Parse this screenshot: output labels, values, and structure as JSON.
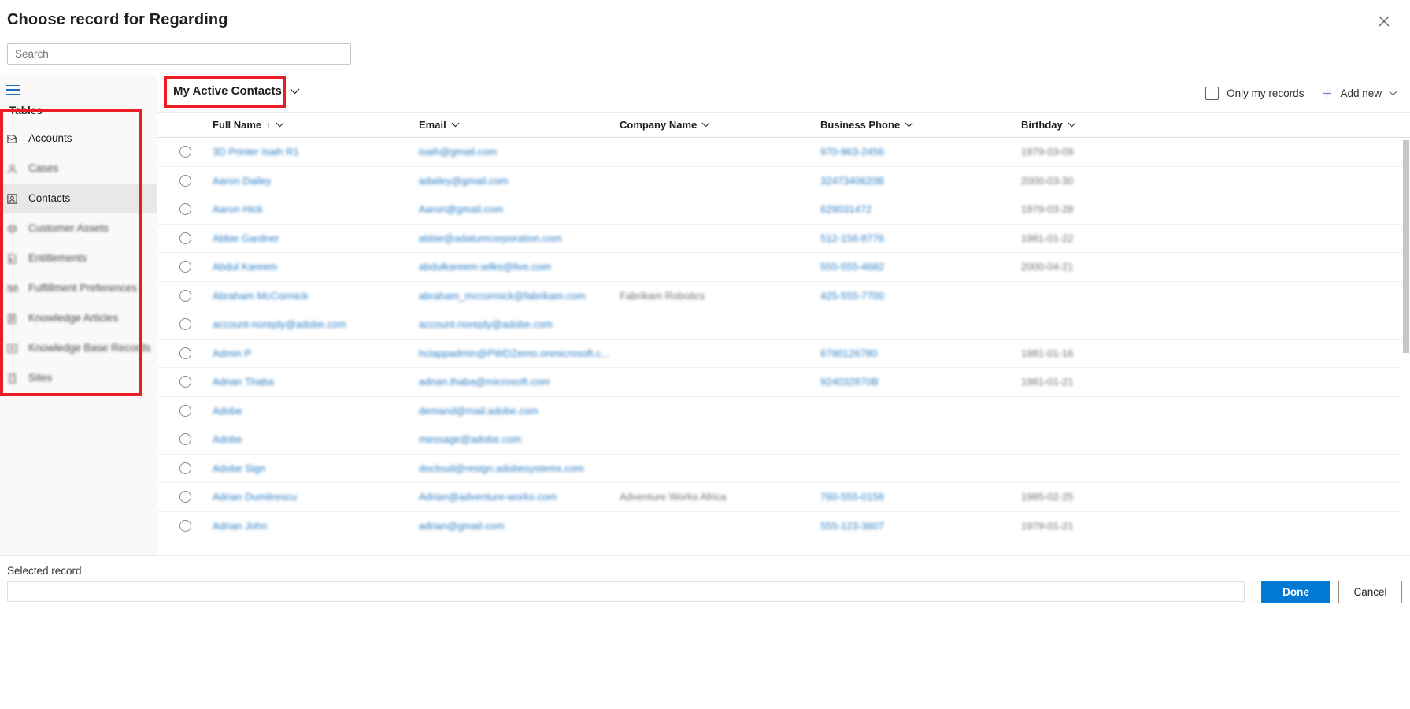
{
  "dialog": {
    "title": "Choose record for Regarding",
    "close_label": "Close"
  },
  "search": {
    "placeholder": "Search",
    "value": ""
  },
  "sidebar": {
    "menu_icon": "hamburger-icon",
    "section_title": "Tables",
    "items": [
      {
        "label": "Accounts",
        "icon": "account-icon",
        "selected": false,
        "blurred": false
      },
      {
        "label": "Cases",
        "icon": "case-icon",
        "selected": false,
        "blurred": true
      },
      {
        "label": "Contacts",
        "icon": "contact-icon",
        "selected": true,
        "blurred": false
      },
      {
        "label": "Customer Assets",
        "icon": "asset-icon",
        "selected": false,
        "blurred": true
      },
      {
        "label": "Entitlements",
        "icon": "entitlement-icon",
        "selected": false,
        "blurred": true
      },
      {
        "label": "Fulfillment Preferences",
        "icon": "people-icon",
        "selected": false,
        "blurred": true
      },
      {
        "label": "Knowledge Articles",
        "icon": "article-icon",
        "selected": false,
        "blurred": true
      },
      {
        "label": "Knowledge Base Records",
        "icon": "kb-icon",
        "selected": false,
        "blurred": true
      },
      {
        "label": "Sites",
        "icon": "site-icon",
        "selected": false,
        "blurred": true
      }
    ]
  },
  "command_bar": {
    "view_name": "My Active Contacts",
    "view_chevron_icon": "chevron-down-icon",
    "only_my_records_label": "Only my records",
    "only_my_records_checked": false,
    "add_new_label": "Add new",
    "add_new_plus_icon": "plus-icon",
    "add_new_chevron_icon": "chevron-down-icon"
  },
  "grid": {
    "columns": [
      {
        "label": "Full Name",
        "sorted": true,
        "sort_icon": "sort-ascending-icon"
      },
      {
        "label": "Email",
        "sorted": false
      },
      {
        "label": "Company Name",
        "sorted": false
      },
      {
        "label": "Business Phone",
        "sorted": false
      },
      {
        "label": "Birthday",
        "sorted": false
      }
    ],
    "rows": [
      {
        "full_name": "3D Printer Isaih R1",
        "email": "isaih@gmail.com",
        "company": "",
        "phone": "970-963-2456",
        "birthday": "1979-03-09"
      },
      {
        "full_name": "Aaron Dailey",
        "email": "adailey@gmail.com",
        "company": "",
        "phone": "3247340620B",
        "birthday": "2000-03-30"
      },
      {
        "full_name": "Aaron Hick",
        "email": "Aaron@gmail.com",
        "company": "",
        "phone": "629031472",
        "birthday": "1979-03-28"
      },
      {
        "full_name": "Abbie Gardner",
        "email": "abbie@adatumcorporation.com",
        "company": "",
        "phone": "512-156-8776",
        "birthday": "1981-01-22"
      },
      {
        "full_name": "Abdul Kareem",
        "email": "abdulkareem.wilks@live.com",
        "company": "",
        "phone": "555-555-4682",
        "birthday": "2000-04-21"
      },
      {
        "full_name": "Abraham McCormick",
        "email": "abraham_mccormick@fabrikam.com",
        "company": "Fabrikam Robotics",
        "phone": "425-555-7700",
        "birthday": ""
      },
      {
        "full_name": "account-noreply@adobe.com",
        "email": "account-noreply@adobe.com",
        "company": "",
        "phone": "",
        "birthday": ""
      },
      {
        "full_name": "Admin P",
        "email": "hclappadmin@PWDZemo.onmicrosoft.c...",
        "company": "",
        "phone": "6790126780",
        "birthday": "1981-01-16"
      },
      {
        "full_name": "Adnan Thaba",
        "email": "adnan.thaba@microsoft.com",
        "company": "",
        "phone": "924032870B",
        "birthday": "1981-01-21"
      },
      {
        "full_name": "Adobe",
        "email": "demand@mail.adobe.com",
        "company": "",
        "phone": "",
        "birthday": ""
      },
      {
        "full_name": "Adobe",
        "email": "message@adobe.com",
        "company": "",
        "phone": "",
        "birthday": ""
      },
      {
        "full_name": "Adobe Sign",
        "email": "docloud@resign.adobesystems.com",
        "company": "",
        "phone": "",
        "birthday": ""
      },
      {
        "full_name": "Adrian Dumitrescu",
        "email": "Adrian@adventure-works.com",
        "company": "Adventure Works Africa",
        "phone": "760-555-0156",
        "birthday": "1985-02-25"
      },
      {
        "full_name": "Adrian John",
        "email": "adrian@gmail.com",
        "company": "",
        "phone": "555-123-3607",
        "birthday": "1979-01-21"
      }
    ]
  },
  "footer": {
    "selected_record_label": "Selected record",
    "selected_record_value": "",
    "done_label": "Done",
    "cancel_label": "Cancel"
  },
  "colors": {
    "accent": "#0078d4",
    "link": "#0f6cbd",
    "annotation": "#ec1c24",
    "nav_selected_bg": "#e9e8e7"
  }
}
